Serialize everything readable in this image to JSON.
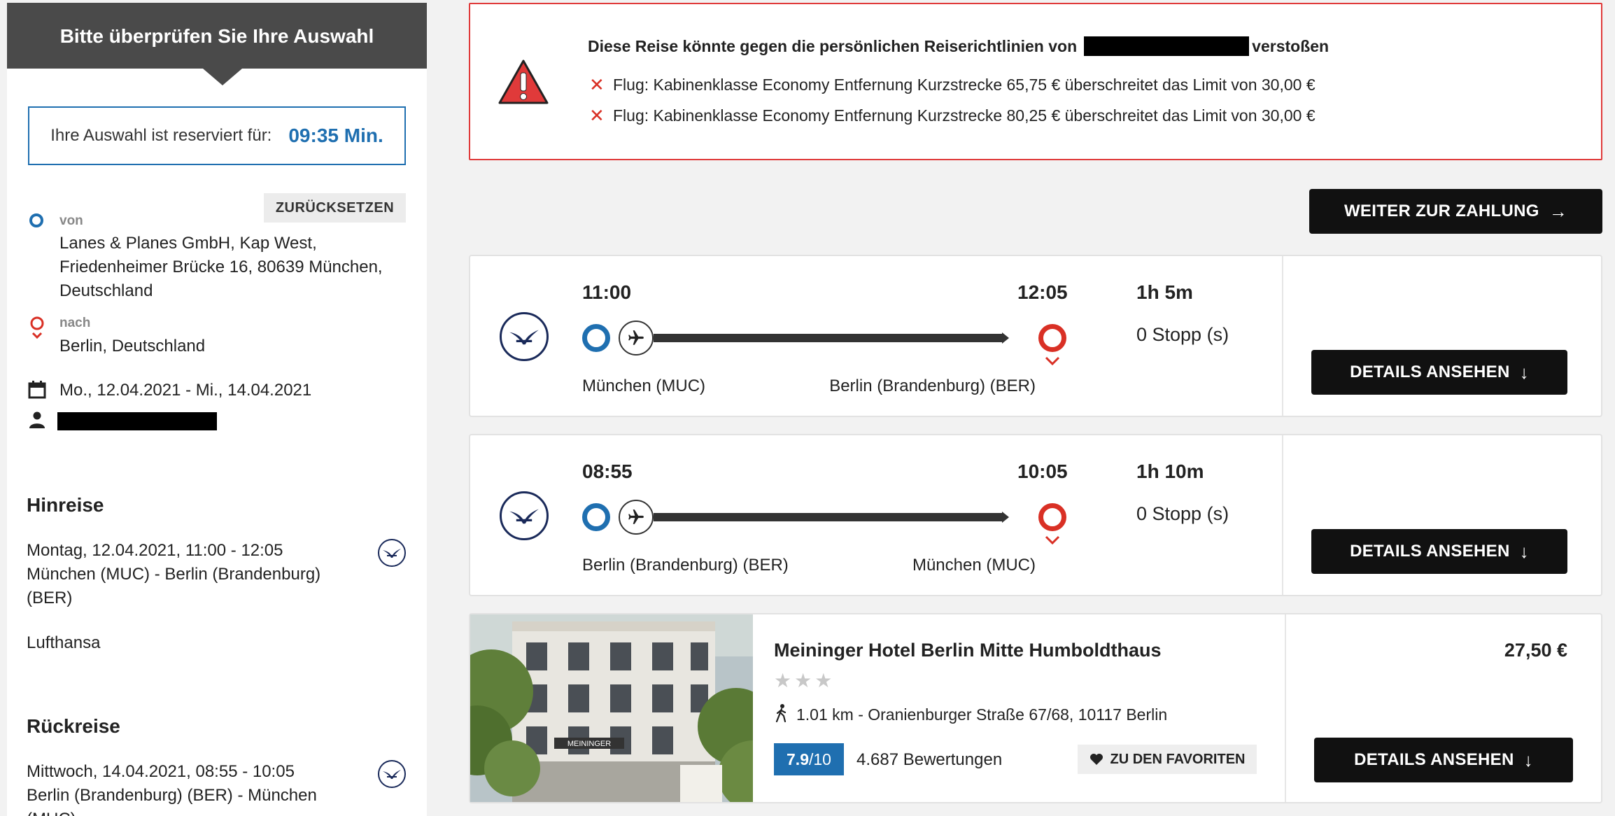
{
  "sidebar": {
    "header_title": "Bitte überprüfen Sie Ihre Auswahl",
    "timer_label": "Ihre Auswahl ist reserviert für:",
    "timer_value": "09:35 Min.",
    "reset_label": "ZURÜCKSETZEN",
    "from_label": "von",
    "from_lines": [
      "Lanes & Planes GmbH, Kap West,",
      "Friedenheimer Brücke 16, 80639 München,",
      "Deutschland"
    ],
    "to_label": "nach",
    "to_value": "Berlin, Deutschland",
    "dates": "Mo., 12.04.2021 - Mi., 14.04.2021",
    "outbound": {
      "title": "Hinreise",
      "datetime": "Montag, 12.04.2021, 11:00 - 12:05",
      "route_line1": "München (MUC) - Berlin (Brandenburg)",
      "route_line2": "(BER)",
      "airline": "Lufthansa"
    },
    "return": {
      "title": "Rückreise",
      "datetime": "Mittwoch, 14.04.2021, 08:55 - 10:05",
      "route_line1": "Berlin (Brandenburg) (BER) - München",
      "route_line2": "(MUC)"
    }
  },
  "alert": {
    "title_before": "Diese Reise könnte gegen die persönlichen Reiserichtlinien von",
    "title_after": "verstoßen",
    "violations": [
      "Flug: Kabinenklasse Economy Entfernung Kurzstrecke 65,75 € überschreitet das Limit von 30,00 €",
      "Flug: Kabinenklasse Economy Entfernung Kurzstrecke 80,25 € überschreitet das Limit von 30,00 €"
    ]
  },
  "continue_button": "WEITER ZUR ZAHLUNG",
  "flights": [
    {
      "depart_time": "11:00",
      "arrive_time": "12:05",
      "duration": "1h 5m",
      "stops": "0 Stopp (s)",
      "origin": "München (MUC)",
      "destination": "Berlin (Brandenburg) (BER)",
      "details_label": "DETAILS ANSEHEN"
    },
    {
      "depart_time": "08:55",
      "arrive_time": "10:05",
      "duration": "1h 10m",
      "stops": "0 Stopp (s)",
      "origin": "Berlin (Brandenburg) (BER)",
      "destination": "München (MUC)",
      "details_label": "DETAILS ANSEHEN"
    }
  ],
  "hotel": {
    "name": "Meininger Hotel Berlin Mitte Humboldthaus",
    "stars": "★★★",
    "address": "1.01 km - Oranienburger Straße 67/68, 10117 Berlin",
    "rating": "7.9",
    "rating_max": "/10",
    "reviews": "4.687 Bewertungen",
    "favorite_label": "ZU DEN FAVORITEN",
    "price": "27,50 €",
    "details_label": "DETAILS ANSEHEN",
    "sign_text": "MEININGER"
  },
  "colors": {
    "accent_blue": "#1f6fb0",
    "alert_red": "#e03a3a",
    "button_black": "#111111"
  }
}
